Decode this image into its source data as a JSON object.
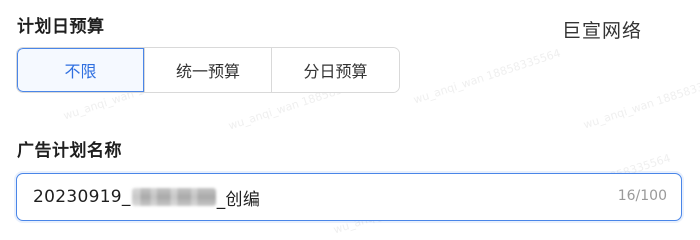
{
  "budget": {
    "title": "计划日预算",
    "options": [
      {
        "label": "不限",
        "active": true
      },
      {
        "label": "统一预算",
        "active": false
      },
      {
        "label": "分日预算",
        "active": false
      }
    ]
  },
  "brand": {
    "text": "巨宣网络"
  },
  "plan_name": {
    "title": "广告计划名称",
    "value_prefix": "20230919_",
    "value_suffix": "_创编",
    "counter": "16/100"
  },
  "watermark": {
    "text": "wu_anqi_wan 18858335564"
  },
  "colors": {
    "accent": "#4a86e8",
    "active_text": "#2f6fe0",
    "border": "#d9d9d9",
    "muted": "#9a9a9a"
  }
}
